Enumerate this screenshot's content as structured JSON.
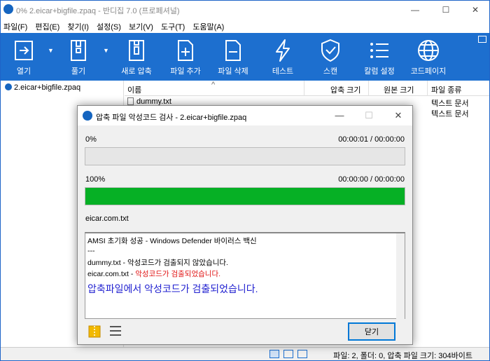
{
  "window": {
    "title": "0% 2.eicar+bigfile.zpaq - 반디집 7.0 (프로페셔널)",
    "minimize": "—",
    "maximize": "☐",
    "close": "✕"
  },
  "menu": [
    "파일(F)",
    "편집(E)",
    "찾기(I)",
    "설정(S)",
    "보기(V)",
    "도구(T)",
    "도움말(A)"
  ],
  "toolbar": {
    "open": "열기",
    "extract": "풀기",
    "new_archive": "새로 압축",
    "add_files": "파일 추가",
    "delete_files": "파일 삭제",
    "test": "테스트",
    "scan": "스캔",
    "column_settings": "칼럼 설정",
    "codepage": "코드페이지"
  },
  "sidebar": {
    "root": "2.eicar+bigfile.zpaq"
  },
  "filelist": {
    "columns": [
      "이름",
      "압축 크기",
      "원본 크기",
      "파일 종류"
    ],
    "sort_indicator": "^",
    "rows": [
      {
        "name": "dummy.txt",
        "type": "텍스트 문서"
      },
      {
        "name": "",
        "type": "텍스트 문서"
      }
    ]
  },
  "statusbar": {
    "text": "파일: 2, 폴더: 0, 압축 파일 크기: 304바이트"
  },
  "dialog": {
    "title": "압축 파일 악성코드 검사 - 2.eicar+bigfile.zpaq",
    "minimize": "—",
    "maximize": "☐",
    "close": "✕",
    "progress1": {
      "percent_label": "0%",
      "time": "00:00:01 / 00:00:00",
      "value": 0
    },
    "progress2": {
      "percent_label": "100%",
      "time": "00:00:00 / 00:00:00",
      "value": 100
    },
    "current_file": "eicar.com.txt",
    "log": {
      "line1": "AMSI 초기화 성공 - Windows Defender 바이러스 백신",
      "line2": "---",
      "line3": "dummy.txt - 악성코드가 검출되지 않았습니다.",
      "line4_name": "eicar.com.txt - ",
      "line4_msg": "악성코드가 검출되었습니다.",
      "summary": "압축파일에서 악성코드가 검출되었습니다."
    },
    "close_button": "닫기"
  },
  "colors": {
    "toolbar_bg": "#1d6fcf",
    "progress_fill": "#06b025",
    "alert_red": "#e01010",
    "summary_blue": "#2020d0"
  }
}
